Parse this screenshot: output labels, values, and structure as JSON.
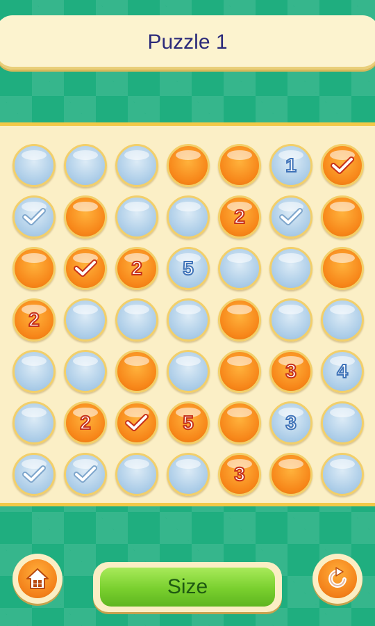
{
  "title": "Puzzle 1",
  "size_button_label": "Size",
  "colors": {
    "orange": "#f7871a",
    "blue": "#a9cbe7",
    "accent": "#f3c948",
    "background": "#1fae7f"
  },
  "icons": {
    "home": "home-icon",
    "restart": "restart-icon",
    "check": "check-icon"
  },
  "grid": [
    [
      {
        "c": "blue"
      },
      {
        "c": "blue"
      },
      {
        "c": "blue"
      },
      {
        "c": "orange"
      },
      {
        "c": "orange"
      },
      {
        "c": "blue",
        "n": "1"
      },
      {
        "c": "orange",
        "check": true
      }
    ],
    [
      {
        "c": "blue",
        "check": true
      },
      {
        "c": "orange"
      },
      {
        "c": "blue"
      },
      {
        "c": "blue"
      },
      {
        "c": "orange",
        "n": "2"
      },
      {
        "c": "blue",
        "check": true
      },
      {
        "c": "orange"
      }
    ],
    [
      {
        "c": "orange"
      },
      {
        "c": "orange",
        "check": true
      },
      {
        "c": "orange",
        "n": "2"
      },
      {
        "c": "blue",
        "n": "5"
      },
      {
        "c": "blue"
      },
      {
        "c": "blue"
      },
      {
        "c": "orange"
      }
    ],
    [
      {
        "c": "orange",
        "n": "2"
      },
      {
        "c": "blue"
      },
      {
        "c": "blue"
      },
      {
        "c": "blue"
      },
      {
        "c": "orange"
      },
      {
        "c": "blue"
      },
      {
        "c": "blue"
      }
    ],
    [
      {
        "c": "blue"
      },
      {
        "c": "blue"
      },
      {
        "c": "orange"
      },
      {
        "c": "blue"
      },
      {
        "c": "orange"
      },
      {
        "c": "orange",
        "n": "3"
      },
      {
        "c": "blue",
        "n": "4"
      }
    ],
    [
      {
        "c": "blue"
      },
      {
        "c": "orange",
        "n": "2"
      },
      {
        "c": "orange",
        "check": true
      },
      {
        "c": "orange",
        "n": "5"
      },
      {
        "c": "orange"
      },
      {
        "c": "blue",
        "n": "3"
      },
      {
        "c": "blue"
      }
    ],
    [
      {
        "c": "blue",
        "check": true
      },
      {
        "c": "blue",
        "check": true
      },
      {
        "c": "blue"
      },
      {
        "c": "blue"
      },
      {
        "c": "orange",
        "n": "3"
      },
      {
        "c": "orange"
      },
      {
        "c": "blue"
      }
    ]
  ]
}
